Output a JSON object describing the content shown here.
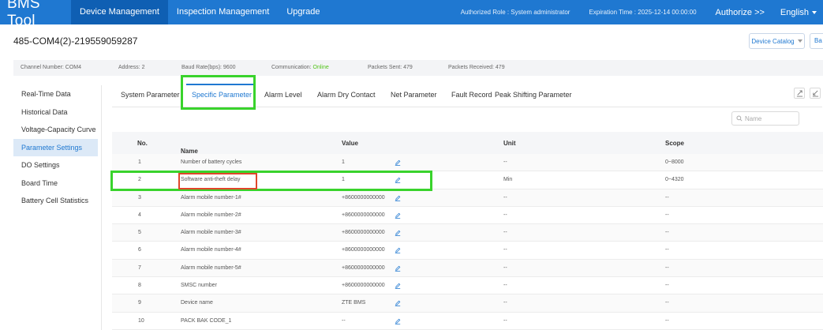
{
  "app": {
    "brand": "BMS Tool",
    "nav": [
      "Device Management",
      "Inspection Management",
      "Upgrade"
    ],
    "authorized_role": "Authorized Role : System administrator",
    "expiration": "Expiration Time : 2025-12-14 00:00:00",
    "authorize": "Authorize >>",
    "language": "English"
  },
  "device": {
    "title": "485-COM4(2)-219559059287",
    "catalog_label": "Device Catalog",
    "ba_label": "Ba"
  },
  "status": {
    "channel": "Channel Number: COM4",
    "address": "Address: 2",
    "baud": "Baud Rate(bps): 9600",
    "communication_label": "Communication:",
    "communication_value": "Online",
    "packets_sent": "Packets Sent: 479",
    "packets_received": "Packets Received: 479"
  },
  "sidebar": {
    "items": [
      "Real-Time Data",
      "Historical Data",
      "Voltage-Capacity Curve",
      "Parameter Settings",
      "DO Settings",
      "Board Time",
      "Battery Cell Statistics"
    ],
    "active_index": 3
  },
  "tabs": {
    "items": [
      "System Parameter",
      "Specific Parameter",
      "Alarm Level",
      "Alarm Dry Contact",
      "Net Parameter",
      "Fault Record",
      "Peak Shifting Parameter"
    ],
    "active_index": 1
  },
  "search": {
    "placeholder": "Name"
  },
  "table": {
    "headers": {
      "no": "No.",
      "name": "Name",
      "value": "Value",
      "unit": "Unit",
      "scope": "Scope"
    },
    "rows": [
      {
        "no": "1",
        "name": "Number of battery cycles",
        "value": "1",
        "unit": "--",
        "scope": "0~8000"
      },
      {
        "no": "2",
        "name": "Software anti-theft delay",
        "value": "1",
        "unit": "Min",
        "scope": "0~4320"
      },
      {
        "no": "3",
        "name": "Alarm mobile number-1#",
        "value": "+8600000000000",
        "unit": "--",
        "scope": "--"
      },
      {
        "no": "4",
        "name": "Alarm mobile number-2#",
        "value": "+8600000000000",
        "unit": "--",
        "scope": "--"
      },
      {
        "no": "5",
        "name": "Alarm mobile number-3#",
        "value": "+8600000000000",
        "unit": "--",
        "scope": "--"
      },
      {
        "no": "6",
        "name": "Alarm mobile number-4#",
        "value": "+8600000000000",
        "unit": "--",
        "scope": "--"
      },
      {
        "no": "7",
        "name": "Alarm mobile number-5#",
        "value": "+8600000000000",
        "unit": "--",
        "scope": "--"
      },
      {
        "no": "8",
        "name": "SMSC number",
        "value": "+8600000000000",
        "unit": "--",
        "scope": "--"
      },
      {
        "no": "9",
        "name": "Device name",
        "value": "ZTE BMS",
        "unit": "--",
        "scope": "--"
      },
      {
        "no": "10",
        "name": "PACK BAK CODE_1",
        "value": "--",
        "unit": "--",
        "scope": "--"
      }
    ]
  },
  "colors": {
    "primary": "#1f78d1",
    "highlight_green": "#39d32c",
    "highlight_red": "#e0462a",
    "online": "#52c41a"
  }
}
